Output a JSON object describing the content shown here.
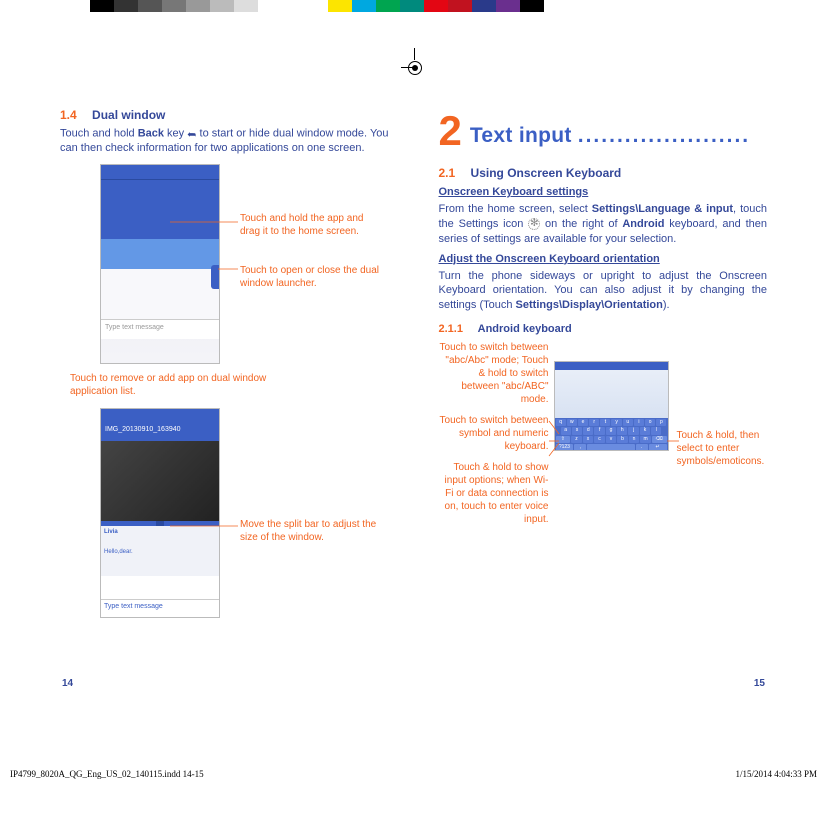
{
  "left": {
    "section_num": "1.4",
    "section_title": "Dual window",
    "p1_a": "Touch and hold ",
    "p1_back": "Back",
    "p1_b": " key ",
    "p1_c": " to start or hide dual window mode. You can then check information for two applications on one screen.",
    "input_placeholder": "Type text message",
    "callout1": "Touch and hold the app and drag it to the home screen.",
    "callout2": "Touch to open or close the dual window launcher.",
    "callout3": "Touch to remove or add app on dual window application list.",
    "screenshot2_header": "IMG_20130910_163940",
    "screenshot2_contact": "Livia",
    "screenshot2_hello": "Hello,dear.",
    "screenshot2_input": "Type text message",
    "callout4": "Move the split bar to adjust the size of the window.",
    "page_num": "14"
  },
  "right": {
    "chapter_num": "2",
    "chapter_title": "Text input",
    "chapter_dots": "......................",
    "s21_num": "2.1",
    "s21_title": "Using Onscreen Keyboard",
    "u1": "Onscreen Keyboard settings",
    "p2_a": "From the home screen, select ",
    "p2_b": "Settings\\Language & input",
    "p2_c": ", touch the Settings icon ",
    "p2_d": " on the right of ",
    "p2_e": "Android",
    "p2_f": " keyboard, and then series of settings are available for your selection.",
    "u2": "Adjust the Onscreen Keyboard orientation",
    "p3_a": "Turn the phone sideways or upright to adjust the Onscreen Keyboard orientation. You can also adjust it by changing the settings (Touch ",
    "p3_b": "Settings\\Display\\Orientation",
    "p3_c": ").",
    "s211_num": "2.1.1",
    "s211_title": "Android keyboard",
    "kb_c1": "Touch to switch between \"abc/Abc\" mode; Touch & hold to switch between \"abc/ABC\" mode.",
    "kb_c2": "Touch to switch between symbol and numeric keyboard.",
    "kb_c3": "Touch & hold to show input options; when Wi-Fi or data connection is on, touch to enter voice input.",
    "kb_c4": "Touch & hold, then select to enter symbols/emoticons.",
    "page_num": "15"
  },
  "footer": {
    "file": "IP4799_8020A_QG_Eng_US_02_140115.indd   14-15",
    "datetime": "1/15/2014   4:04:33 PM"
  }
}
